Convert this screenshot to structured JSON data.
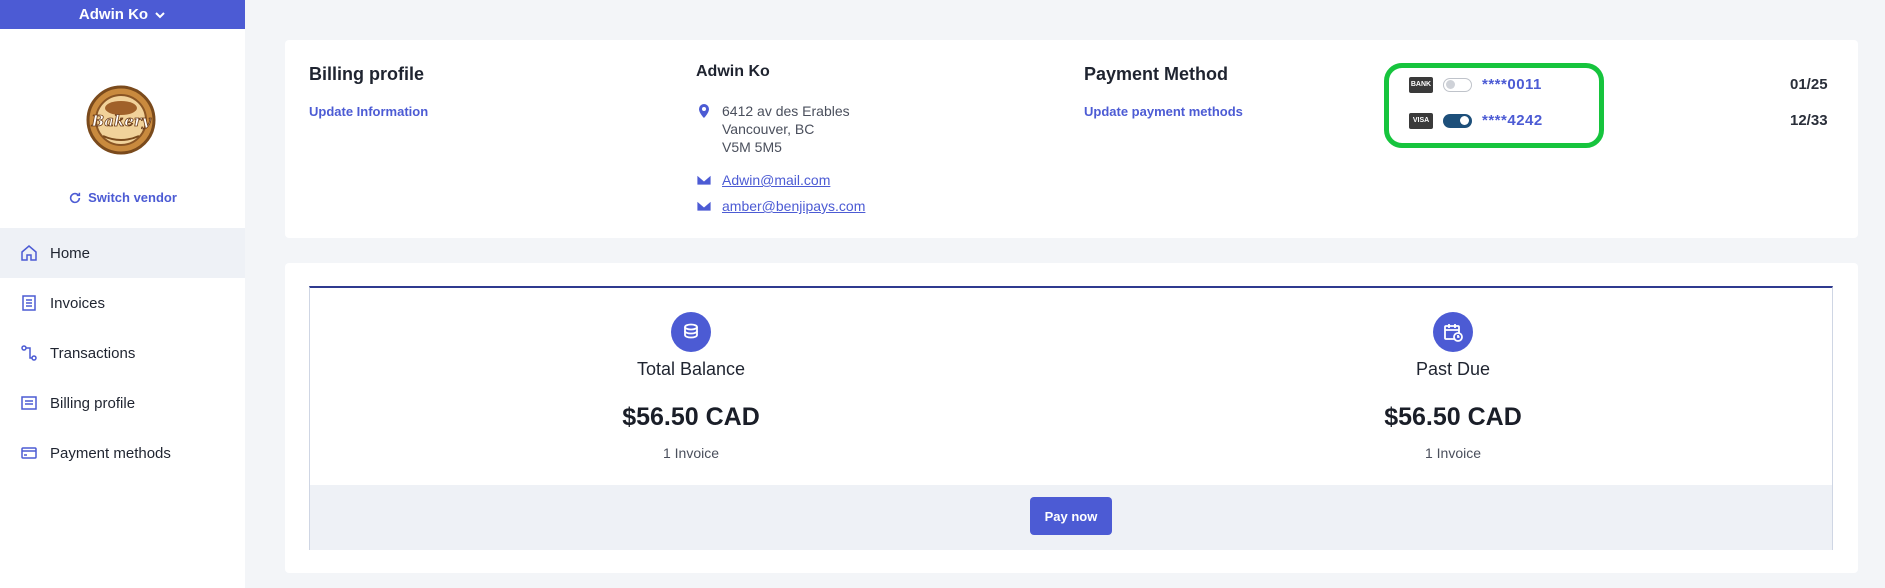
{
  "user": {
    "name": "Adwin Ko"
  },
  "vendor": {
    "logo_text": "Bakery",
    "switch_label": "Switch vendor"
  },
  "nav": {
    "items": [
      {
        "label": "Home",
        "icon": "home-icon",
        "active": true
      },
      {
        "label": "Invoices",
        "icon": "invoice-icon"
      },
      {
        "label": "Transactions",
        "icon": "transactions-icon"
      },
      {
        "label": "Billing profile",
        "icon": "billing-profile-icon"
      },
      {
        "label": "Payment methods",
        "icon": "credit-card-icon"
      }
    ]
  },
  "billing": {
    "title": "Billing profile",
    "update_link": "Update Information",
    "contact_name": "Adwin Ko",
    "address_line1": "6412 av des Erables",
    "address_line2": "Vancouver, BC",
    "address_line3": "V5M 5M5",
    "emails": [
      "Adwin@mail.com",
      "amber@benjipays.com"
    ]
  },
  "payment": {
    "title": "Payment Method",
    "update_link": "Update payment methods",
    "methods": [
      {
        "brand": "BANK",
        "number": "****0011",
        "expiry": "01/25",
        "enabled": false
      },
      {
        "brand": "VISA",
        "number": "****4242",
        "expiry": "12/33",
        "enabled": true
      }
    ],
    "highlight_color": "#16c43d"
  },
  "summary": {
    "total": {
      "label": "Total Balance",
      "amount": "$56.50 CAD",
      "sub": "1 Invoice"
    },
    "past_due": {
      "label": "Past Due",
      "amount": "$56.50 CAD",
      "sub": "1 Invoice"
    },
    "pay_button": "Pay now"
  },
  "colors": {
    "accent": "#4c5bd4",
    "toggle_on": "#1d4f7a"
  }
}
